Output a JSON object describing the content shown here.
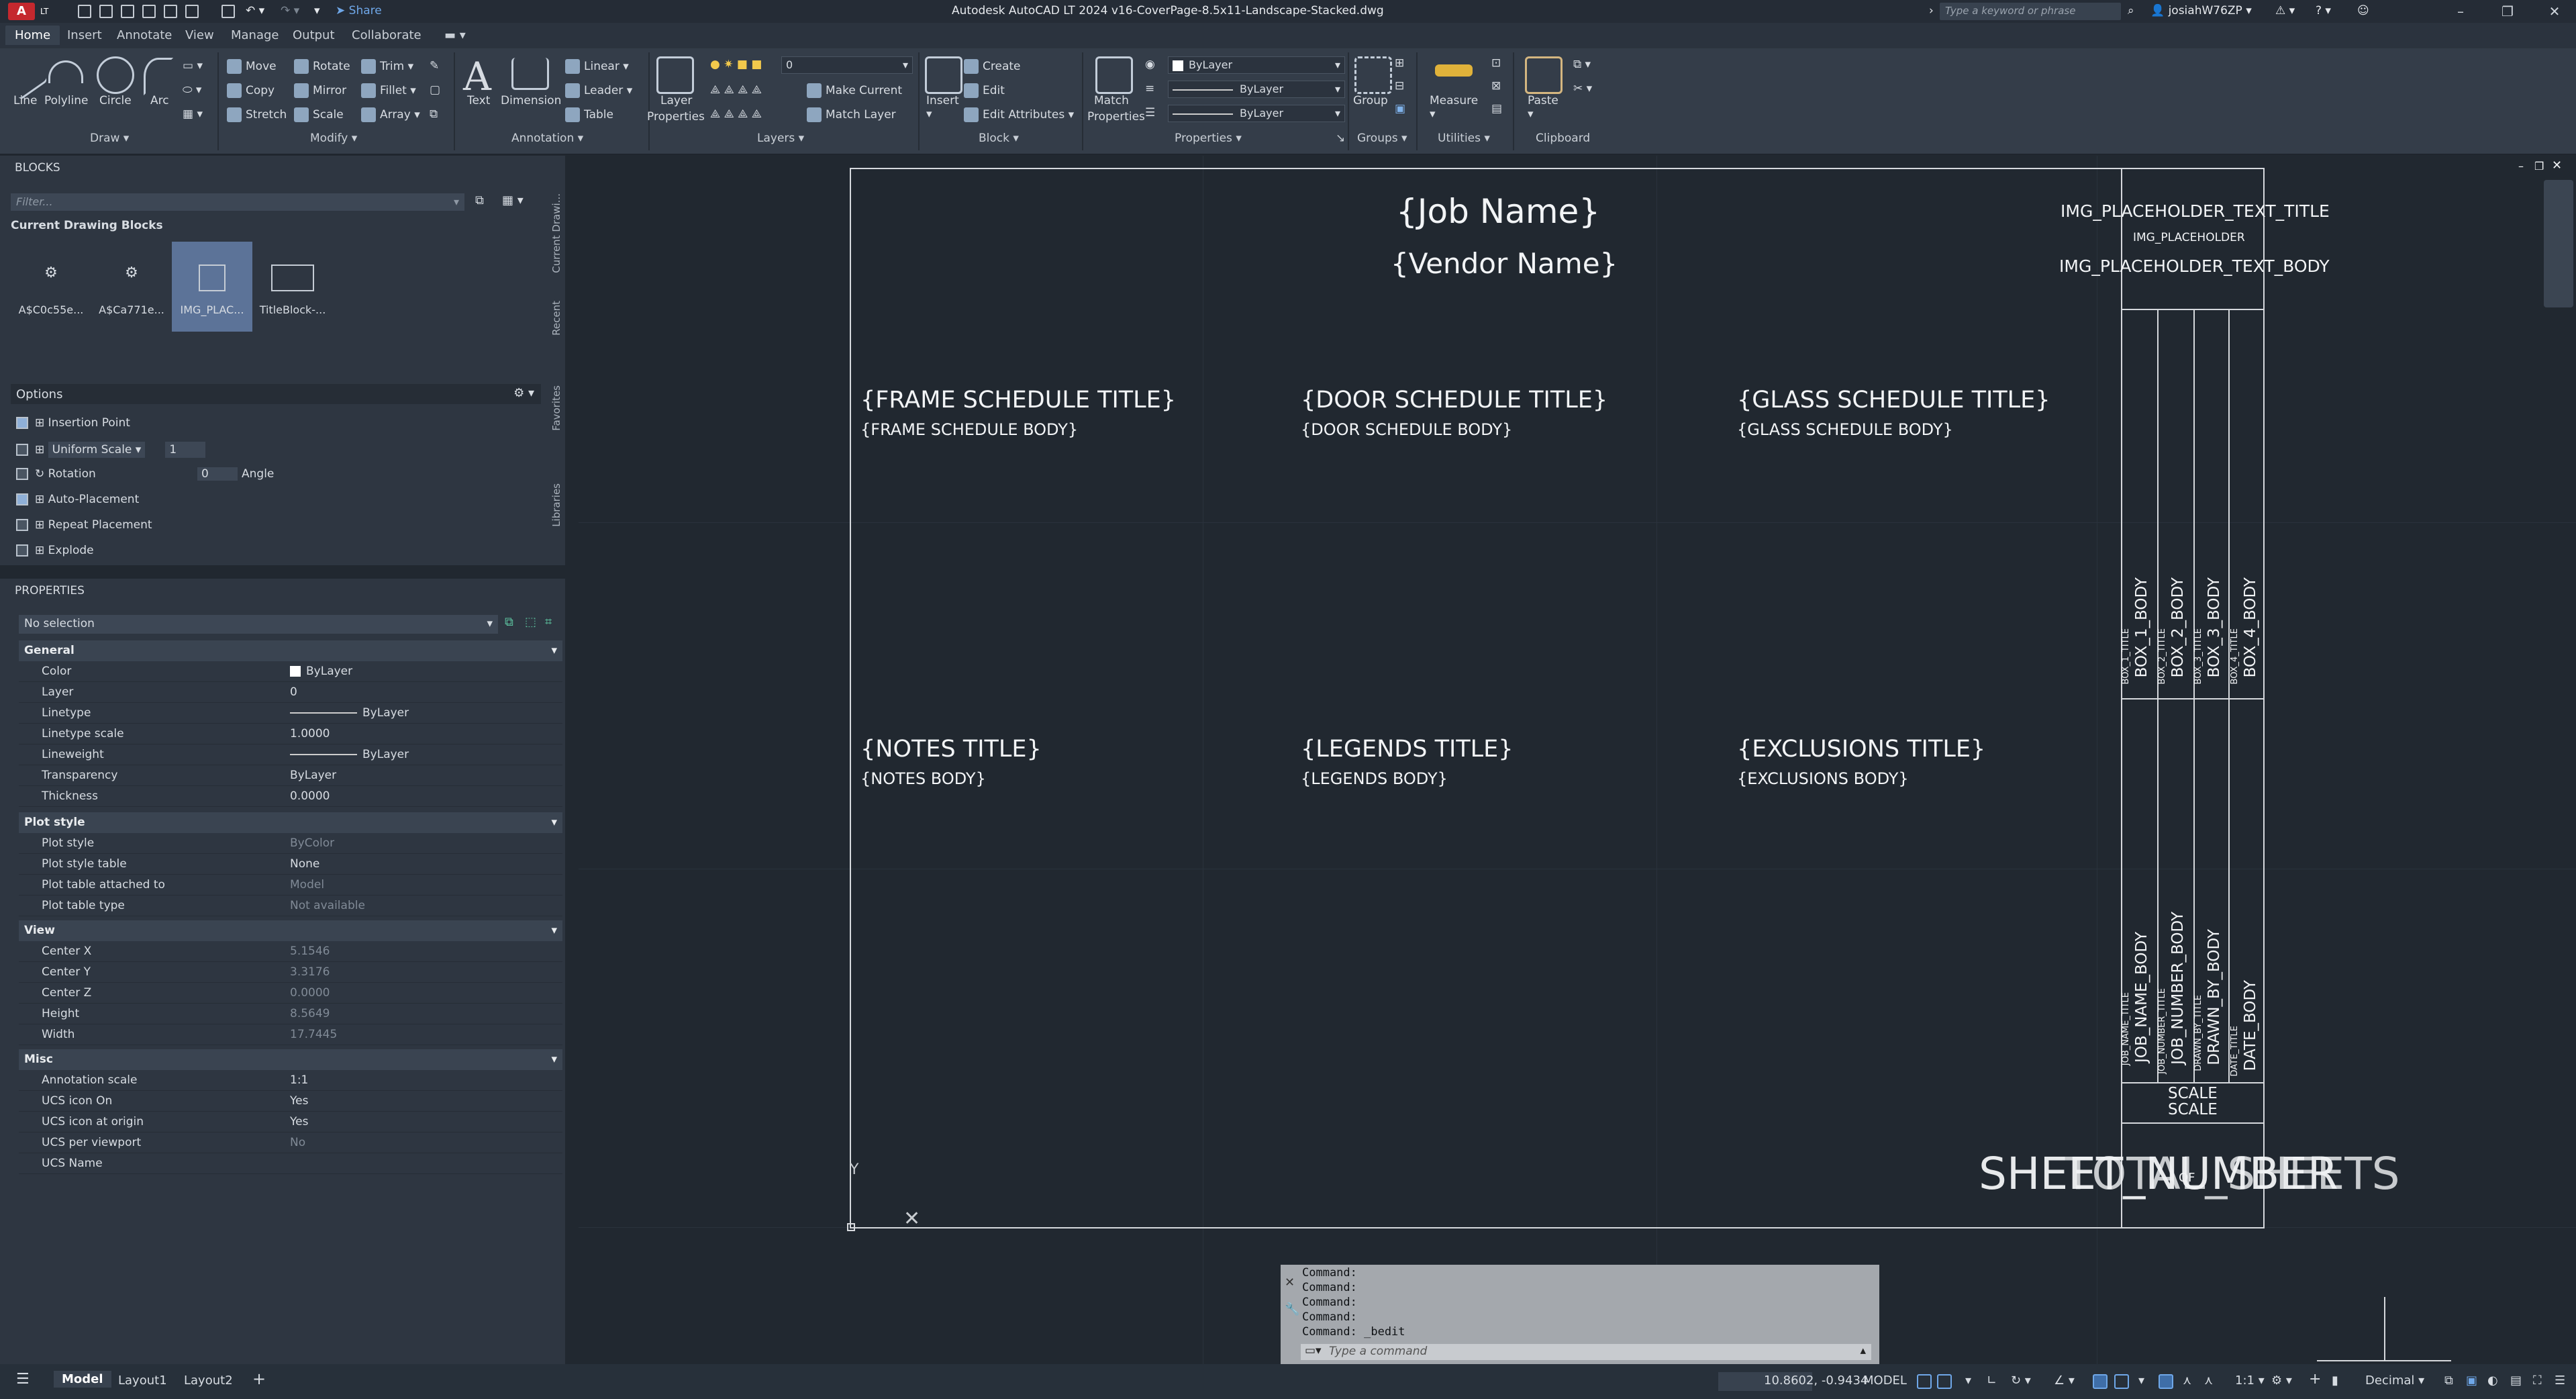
{
  "titlebar": {
    "logo": "A",
    "lt_badge": "LT",
    "share": "Share",
    "title": "Autodesk AutoCAD LT 2024    v16-CoverPage-8.5x11-Landscape-Stacked.dwg",
    "search_placeholder": "Type a keyword or phrase",
    "user": "josiahW76ZP"
  },
  "ribbon_tabs": [
    "Home",
    "Insert",
    "Annotate",
    "View",
    "Manage",
    "Output",
    "Collaborate"
  ],
  "ribbon": {
    "draw": {
      "line": "Line",
      "polyline": "Polyline",
      "circle": "Circle",
      "arc": "Arc",
      "panel": "Draw"
    },
    "modify": {
      "move": "Move",
      "rotate": "Rotate",
      "trim": "Trim",
      "copy": "Copy",
      "mirror": "Mirror",
      "fillet": "Fillet",
      "stretch": "Stretch",
      "scale": "Scale",
      "array": "Array",
      "panel": "Modify"
    },
    "annotation": {
      "text": "Text",
      "dimension": "Dimension",
      "linear": "Linear",
      "leader": "Leader",
      "table": "Table",
      "panel": "Annotation"
    },
    "layers": {
      "layer_properties_1": "Layer",
      "layer_properties_2": "Properties",
      "current_layer": "0",
      "make_current": "Make Current",
      "match_layer": "Match Layer",
      "panel": "Layers"
    },
    "block": {
      "insert": "Insert",
      "create": "Create",
      "edit": "Edit",
      "edit_attributes": "Edit Attributes",
      "panel": "Block"
    },
    "properties": {
      "match_1": "Match",
      "match_2": "Properties",
      "color": "ByLayer",
      "lineweight": "ByLayer",
      "linetype": "ByLayer",
      "panel": "Properties"
    },
    "groups": {
      "group": "Group",
      "panel": "Groups"
    },
    "utilities": {
      "measure": "Measure",
      "panel": "Utilities"
    },
    "clipboard": {
      "paste": "Paste",
      "panel": "Clipboard"
    }
  },
  "blocks_palette": {
    "title": "BLOCKS",
    "filter_placeholder": "Filter...",
    "section": "Current Drawing Blocks",
    "items": [
      "A$C0c55e...",
      "A$Ca771e...",
      "IMG_PLAC...",
      "TitleBlock-..."
    ],
    "tabs": [
      "Current Drawi...",
      "Recent",
      "Favorites",
      "Libraries"
    ],
    "options_title": "Options",
    "options": {
      "insertion_point": "Insertion Point",
      "uniform_scale": "Uniform Scale",
      "scale_value": "1",
      "rotation": "Rotation",
      "rotation_value": "0",
      "angle": "Angle",
      "auto_placement": "Auto-Placement",
      "repeat_placement": "Repeat Placement",
      "explode": "Explode"
    }
  },
  "properties_palette": {
    "title": "PROPERTIES",
    "selection": "No selection",
    "general": {
      "title": "General",
      "rows": [
        [
          "Color",
          "ByLayer"
        ],
        [
          "Layer",
          "0"
        ],
        [
          "Linetype",
          "ByLayer"
        ],
        [
          "Linetype scale",
          "1.0000"
        ],
        [
          "Lineweight",
          "ByLayer"
        ],
        [
          "Transparency",
          "ByLayer"
        ],
        [
          "Thickness",
          "0.0000"
        ]
      ]
    },
    "plot_style": {
      "title": "Plot style",
      "rows": [
        [
          "Plot style",
          "ByColor"
        ],
        [
          "Plot style table",
          "None"
        ],
        [
          "Plot table attached to",
          "Model"
        ],
        [
          "Plot table type",
          "Not available"
        ]
      ]
    },
    "view": {
      "title": "View",
      "rows": [
        [
          "Center X",
          "5.1546"
        ],
        [
          "Center Y",
          "3.3176"
        ],
        [
          "Center Z",
          "0.0000"
        ],
        [
          "Height",
          "8.5649"
        ],
        [
          "Width",
          "17.7445"
        ]
      ]
    },
    "misc": {
      "title": "Misc",
      "rows": [
        [
          "Annotation scale",
          "1:1"
        ],
        [
          "UCS icon On",
          "Yes"
        ],
        [
          "UCS icon at origin",
          "Yes"
        ],
        [
          "UCS per viewport",
          "No"
        ],
        [
          "UCS Name",
          ""
        ]
      ]
    }
  },
  "drawing": {
    "job_name": "{Job Name}",
    "vendor_name": "{Vendor Name}",
    "img_title": "IMG_PLACEHOLDER_TEXT_TITLE",
    "img_placeholder": "IMG_PLACEHOLDER",
    "img_body": "IMG_PLACEHOLDER_TEXT_BODY",
    "frame_title": "{FRAME SCHEDULE TITLE}",
    "frame_body": "{FRAME SCHEDULE BODY}",
    "door_title": "{DOOR SCHEDULE TITLE}",
    "door_body": "{DOOR SCHEDULE BODY}",
    "glass_title": "{GLASS SCHEDULE TITLE}",
    "glass_body": "{GLASS SCHEDULE BODY}",
    "notes_title": "{NOTES TITLE}",
    "notes_body": "{NOTES BODY}",
    "legends_title": "{LEGENDS TITLE}",
    "legends_body": "{LEGENDS BODY}",
    "exclusions_title": "{EXCLUSIONS TITLE}",
    "exclusions_body": "{EXCLUSIONS BODY}",
    "box_bodies": [
      "BOX_1_BODY",
      "BOX_2_BODY",
      "BOX_3_BODY",
      "BOX_4_BODY"
    ],
    "box_titles": [
      "BOX_1_TITLE",
      "BOX_2_TITLE",
      "BOX_3_TITLE",
      "BOX_4_TITLE"
    ],
    "info_bodies": [
      "JOB_NAME_BODY",
      "JOB_NUMBER_BODY",
      "DRAWN_BY_BODY",
      "DATE_BODY"
    ],
    "info_titles": [
      "JOB_NAME_TITLE",
      "JOB_NUMBER_TITLE",
      "DRAWN_BY_TITLE",
      "DATE_TITLE"
    ],
    "scale_1": "SCALE",
    "scale_2": "SCALE",
    "sheet_a": "SHEET_NUMBER",
    "sheet_b": "TOTAL_SHEETS",
    "sheet_of": "OF",
    "ucs_y": "Y"
  },
  "command": {
    "lines": [
      "Command:",
      "Command:",
      "Command:",
      "Command:",
      "Command: _bedit"
    ],
    "placeholder": "Type a command"
  },
  "status": {
    "layout_tabs": [
      "Model",
      "Layout1",
      "Layout2"
    ],
    "coords": "10.8602, -0.9434",
    "space": "MODEL",
    "scale": "1:1",
    "units": "Decimal"
  }
}
